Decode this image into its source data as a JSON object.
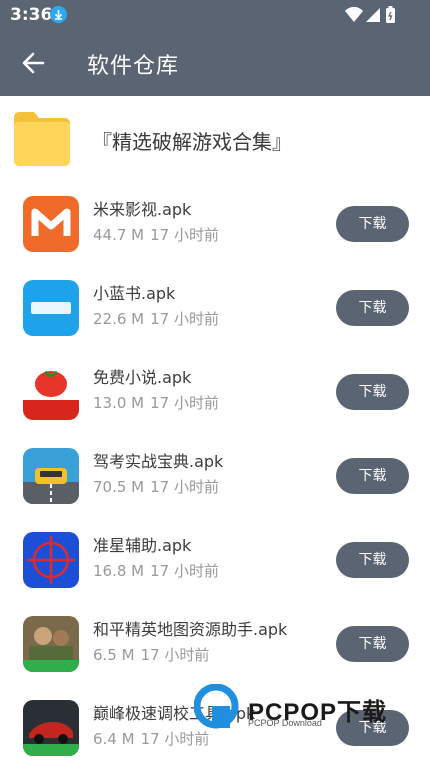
{
  "status_bar": {
    "time": "3:36"
  },
  "app_bar": {
    "title": "软件仓库"
  },
  "folder": {
    "label": "『精选破解游戏合集』"
  },
  "download_label": "下载",
  "apps": [
    {
      "name": "米来影视.apk",
      "size": "44.7 M",
      "time": "17 小时前",
      "icon": "milai-video-icon",
      "color": "#f06a2a"
    },
    {
      "name": "小蓝书.apk",
      "size": "22.6 M",
      "time": "17 小时前",
      "icon": "xiaolanshu-icon",
      "color": "#1ea3ea"
    },
    {
      "name": "免费小说.apk",
      "size": "13.0 M",
      "time": "17 小时前",
      "icon": "tomato-novel-icon",
      "color": "#e8352a"
    },
    {
      "name": "驾考实战宝典.apk",
      "size": "70.5 M",
      "time": "17 小时前",
      "icon": "driving-test-icon",
      "color": "#3aa0d8"
    },
    {
      "name": "准星辅助.apk",
      "size": "16.8 M",
      "time": "17 小时前",
      "icon": "crosshair-icon",
      "color": "#1d4fd6"
    },
    {
      "name": "和平精英地图资源助手.apk",
      "size": "6.5 M",
      "time": "17 小时前",
      "icon": "game-map-icon",
      "color": "#5f8c3a"
    },
    {
      "name": "巅峰极速调校工具.apk",
      "size": "6.4 M",
      "time": "17 小时前",
      "icon": "racing-tuning-icon",
      "color": "#c2261f"
    }
  ],
  "watermark": {
    "text": "PCPOP下载",
    "sub": "PCPOP Download"
  }
}
